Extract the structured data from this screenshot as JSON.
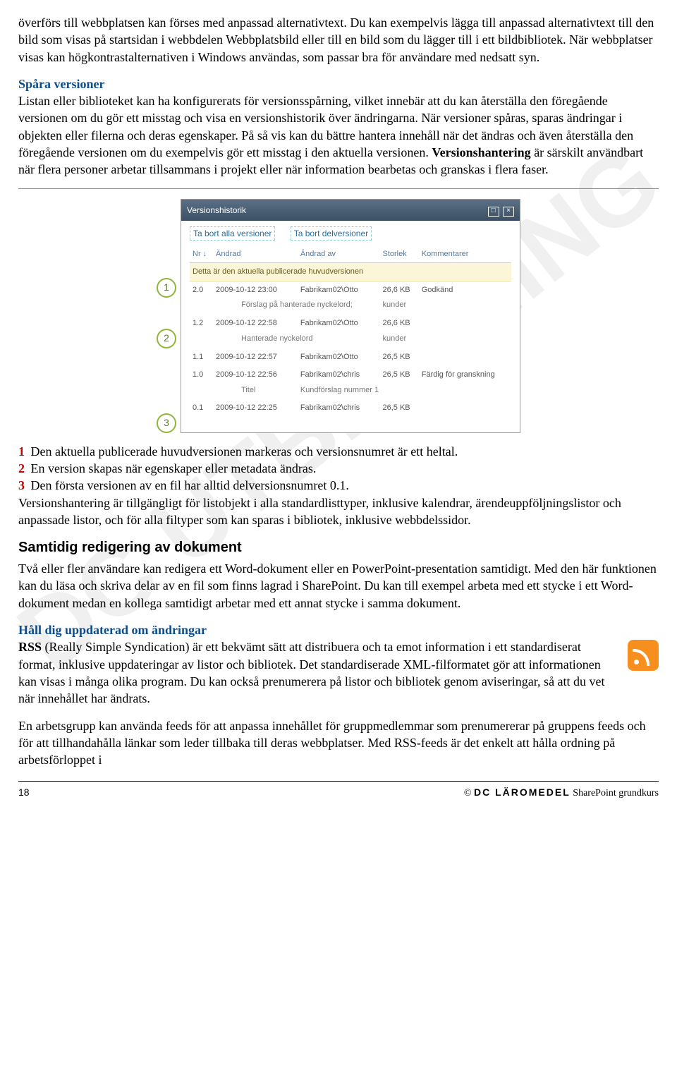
{
  "watermark": "DC UTBILDNING",
  "para1": "överförs till webbplatsen kan förses med anpassad alternativtext. Du kan exempelvis lägga till anpassad alternativtext till den bild som visas på startsidan i webbdelen Webbplatsbild eller till en bild som du lägger till i ett bildbibliotek. När webbplatser visas kan högkontrastalternativen i Windows användas, som passar bra för användare med nedsatt syn.",
  "h_spara": "Spåra versioner",
  "para2a": "Listan eller biblioteket kan ha konfigurerats för versionsspårning, vilket innebär att du kan återställa den föregående versionen om du gör ett misstag och visa en versionshistorik över ändringarna. När versioner spåras, sparas ändringar i objekten eller filerna och deras egenskaper. På så vis kan du bättre hantera innehåll när det ändras och även återställa den föregående versionen om du exempelvis gör ett misstag i den aktuella versionen. ",
  "para2b": "Versionshantering",
  "para2c": " är särskilt användbart när flera personer arbetar tillsammans i projekt eller när information bearbetas och granskas i flera faser.",
  "dialog": {
    "title": "Versionshistorik",
    "link1": "Ta bort alla versioner",
    "link2": "Ta bort delversioner",
    "cols": {
      "nr": "Nr ↓",
      "andrad": "Ändrad",
      "andrad_av": "Ändrad av",
      "storlek": "Storlek",
      "komm": "Kommentarer"
    },
    "banner": "Detta är den aktuella publicerade huvudversionen",
    "rows": [
      {
        "ver": "2.0",
        "date": "2009-10-12 23:00",
        "by": "Fabrikam02\\Otto",
        "size": "26,6 KB",
        "comm": "Godkänd"
      },
      {
        "sub": true,
        "label": "Förslag på hanterade nyckelord;",
        "val": "kunder"
      },
      {
        "ver": "1.2",
        "date": "2009-10-12 22:58",
        "by": "Fabrikam02\\Otto",
        "size": "26,6 KB",
        "comm": ""
      },
      {
        "sub": true,
        "label": "Hanterade nyckelord",
        "val": "kunder"
      },
      {
        "ver": "1.1",
        "date": "2009-10-12 22:57",
        "by": "Fabrikam02\\Otto",
        "size": "26,5 KB",
        "comm": ""
      },
      {
        "ver": "1.0",
        "date": "2009-10-12 22:56",
        "by": "Fabrikam02\\chris",
        "size": "26,5 KB",
        "comm": "Färdig för granskning"
      },
      {
        "sub": true,
        "label": "Titel",
        "val": "Kundförslag nummer 1"
      },
      {
        "ver": "0.1",
        "date": "2009-10-12 22:25",
        "by": "Fabrikam02\\chris",
        "size": "26,5 KB",
        "comm": ""
      }
    ]
  },
  "callout1": "1",
  "callout2": "2",
  "callout3": "3",
  "li1": " Den aktuella publicerade huvudversionen markeras och versionsnumret är ett heltal.",
  "li2": " En version skapas när egenskaper eller metadata ändras.",
  "li3": " Den första versionen av en fil har alltid delversionsnumret 0.1.",
  "para3": "Versionshantering är tillgängligt för listobjekt i alla standardlisttyper, inklusive kalendrar, ärendeuppföljningslistor och anpassade listor, och för alla filtyper som kan sparas i bibliotek, inklusive webbdelssidor.",
  "h_samtidig": "Samtidig redigering av dokument",
  "para4": "Två eller fler användare kan redigera ett Word-dokument eller en PowerPoint-presentation samtidigt. Med den här funktionen kan du läsa och skriva delar av en fil som finns lagrad i SharePoint. Du kan till exempel arbeta med ett stycke i ett Word-dokument medan en kollega samtidigt arbetar med ett annat stycke i samma dokument.",
  "h_hall": "Håll dig uppdaterad om ändringar",
  "rss_b": "RSS",
  "para5": " (Really Simple Syndication) är ett bekvämt sätt att distribuera och ta emot information i ett standardiserat format, inklusive uppdateringar av listor och bibliotek. Det standardiserade XML-filformatet gör att informationen kan visas i många olika program. Du kan också prenumerera på listor och bibliotek genom aviseringar, så att du vet när innehållet har ändrats.",
  "para6": "En arbetsgrupp kan använda feeds för att anpassa innehållet för gruppmedlemmar som prenumererar på gruppens feeds och för att tillhandahålla länkar som leder tillbaka till deras webbplatser. Med RSS-feeds är det enkelt att hålla ordning på arbetsförloppet i",
  "footer": {
    "page": "18",
    "copy": "©",
    "brand": "DC LÄROMEDEL",
    "course": " SharePoint grundkurs"
  }
}
